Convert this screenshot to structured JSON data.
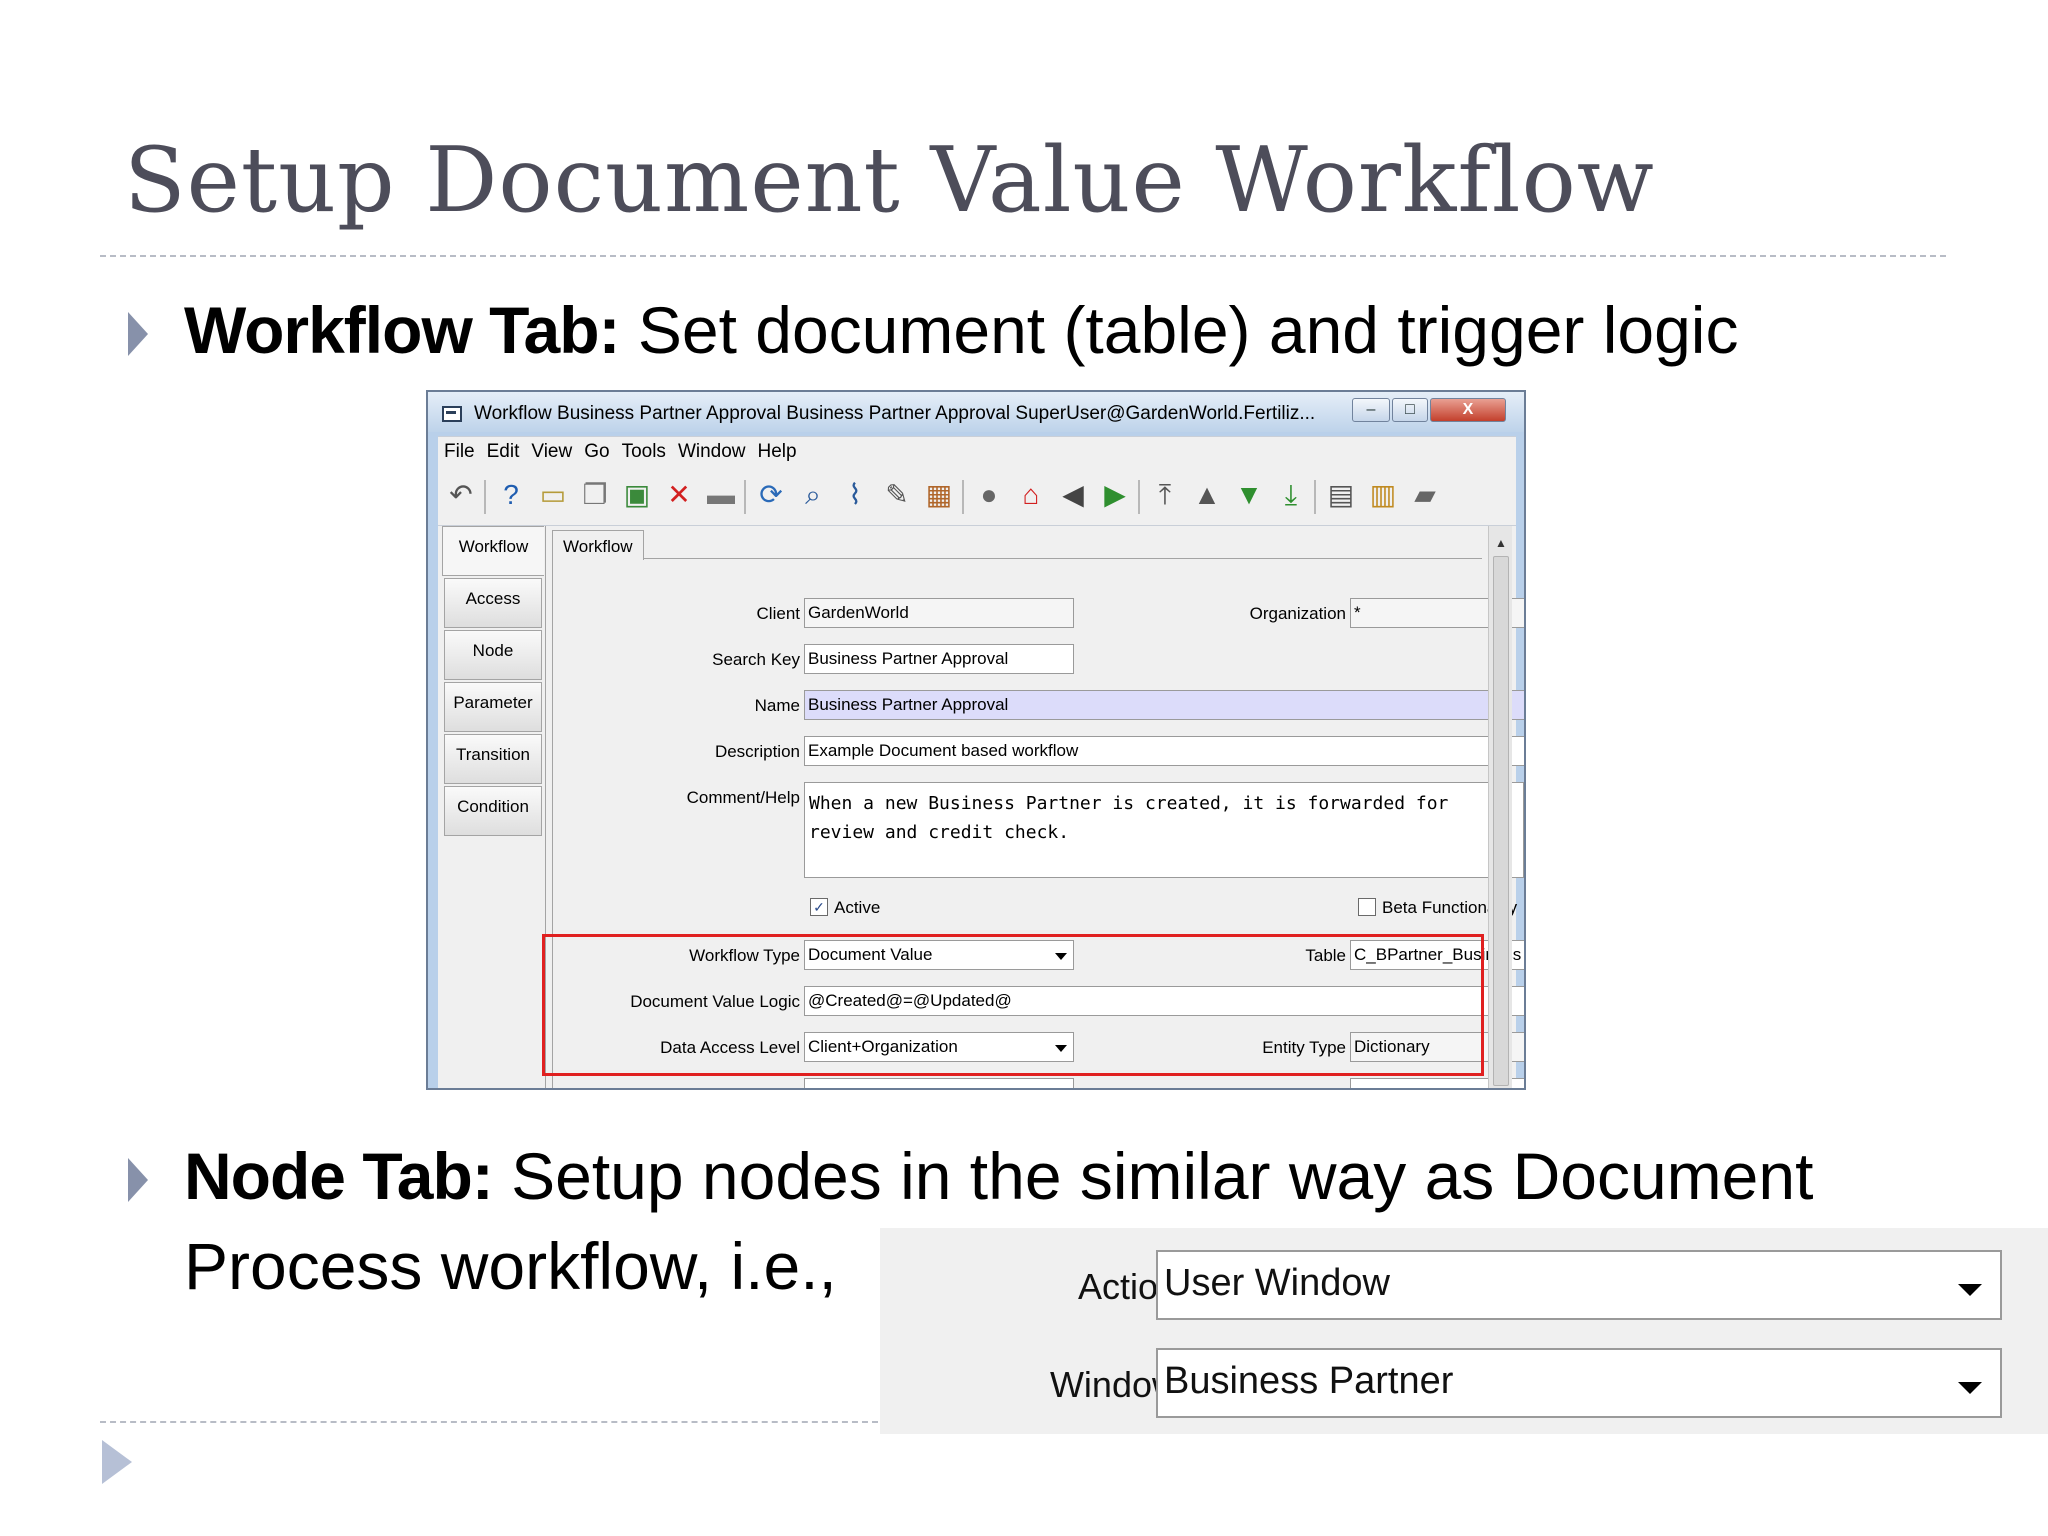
{
  "slide": {
    "title": "Setup Document Value Workflow",
    "bullet1_bold": "Workflow Tab:",
    "bullet1_text": " Set document (table) and trigger logic",
    "bullet2_bold": "Node Tab:",
    "bullet2_text": " Setup nodes in the similar way as Document",
    "bullet2_line2": "Process workflow, i.e.,"
  },
  "window": {
    "title": "Workflow  Business Partner Approval  Business Partner Approval  SuperUser@GardenWorld.Fertiliz...",
    "controls": {
      "minimize": "–",
      "maximize": "□",
      "close": "X"
    },
    "menu": [
      "File",
      "Edit",
      "View",
      "Go",
      "Tools",
      "Window",
      "Help"
    ],
    "toolbar_icons": [
      {
        "name": "undo-icon",
        "glyph": "↶",
        "color": "#555555"
      },
      {
        "name": "help-icon",
        "glyph": "?",
        "color": "#1f5db0"
      },
      {
        "name": "new-record-icon",
        "glyph": "▭",
        "color": "#b59b3a"
      },
      {
        "name": "copy-record-icon",
        "glyph": "❐",
        "color": "#777777"
      },
      {
        "name": "save-icon",
        "glyph": "▣",
        "color": "#3b8a3b"
      },
      {
        "name": "delete-icon",
        "glyph": "✕",
        "color": "#d22020"
      },
      {
        "name": "save-disk-icon",
        "glyph": "▬",
        "color": "#777777"
      },
      {
        "name": "refresh-icon",
        "glyph": "⟳",
        "color": "#2a6ab8"
      },
      {
        "name": "find-icon",
        "glyph": "⌕",
        "color": "#2a5a9a"
      },
      {
        "name": "attachment-icon",
        "glyph": "⌇",
        "color": "#2a5a9a"
      },
      {
        "name": "chat-icon",
        "glyph": "✎",
        "color": "#555555"
      },
      {
        "name": "grid-toggle-icon",
        "glyph": "▦",
        "color": "#b0662a"
      },
      {
        "name": "history-icon",
        "glyph": "●",
        "color": "#666666"
      },
      {
        "name": "home-icon",
        "glyph": "⌂",
        "color": "#d22020"
      },
      {
        "name": "back-icon",
        "glyph": "◀",
        "color": "#444444"
      },
      {
        "name": "forward-icon",
        "glyph": "▶",
        "color": "#2f8f2f"
      },
      {
        "name": "first-record-icon",
        "glyph": "⤒",
        "color": "#555555"
      },
      {
        "name": "previous-record-icon",
        "glyph": "▲",
        "color": "#555555"
      },
      {
        "name": "next-record-icon",
        "glyph": "▼",
        "color": "#2f8f2f"
      },
      {
        "name": "last-record-icon",
        "glyph": "⤓",
        "color": "#2f8f2f"
      },
      {
        "name": "report-icon",
        "glyph": "▤",
        "color": "#555555"
      },
      {
        "name": "archive-icon",
        "glyph": "▥",
        "color": "#c08a20"
      },
      {
        "name": "print-icon",
        "glyph": "▰",
        "color": "#666666"
      }
    ],
    "side_tabs": [
      "Workflow",
      "Access",
      "Node",
      "Parameter",
      "Transition",
      "Condition"
    ],
    "panel_tab": "Workflow",
    "fields": {
      "client_label": "Client",
      "client_value": "GardenWorld",
      "organization_label": "Organization",
      "organization_value": "*",
      "search_key_label": "Search Key",
      "search_key_value": "Business Partner Approval",
      "name_label": "Name",
      "name_value": "Business Partner Approval",
      "description_label": "Description",
      "description_value": "Example Document based workflow",
      "comment_label": "Comment/Help",
      "comment_value": "When a new Business Partner is created, it is forwarded for review and credit check.",
      "active_label": "Active",
      "active_checked": "✓",
      "beta_label": "Beta Functionality",
      "workflow_type_label": "Workflow Type",
      "workflow_type_value": "Document Value",
      "table_label": "Table",
      "table_value": "C_BPartner_Business Partner",
      "doc_value_logic_label": "Document Value Logic",
      "doc_value_logic_value": "@Created@=@Updated@",
      "data_access_label": "Data Access Level",
      "data_access_value": "Client+Organization",
      "entity_type_label": "Entity Type",
      "entity_type_value": "Dictionary"
    }
  },
  "node_inset": {
    "action_label": "Action",
    "action_value": "User Window",
    "window_label": "Window",
    "window_value": "Business Partner"
  }
}
